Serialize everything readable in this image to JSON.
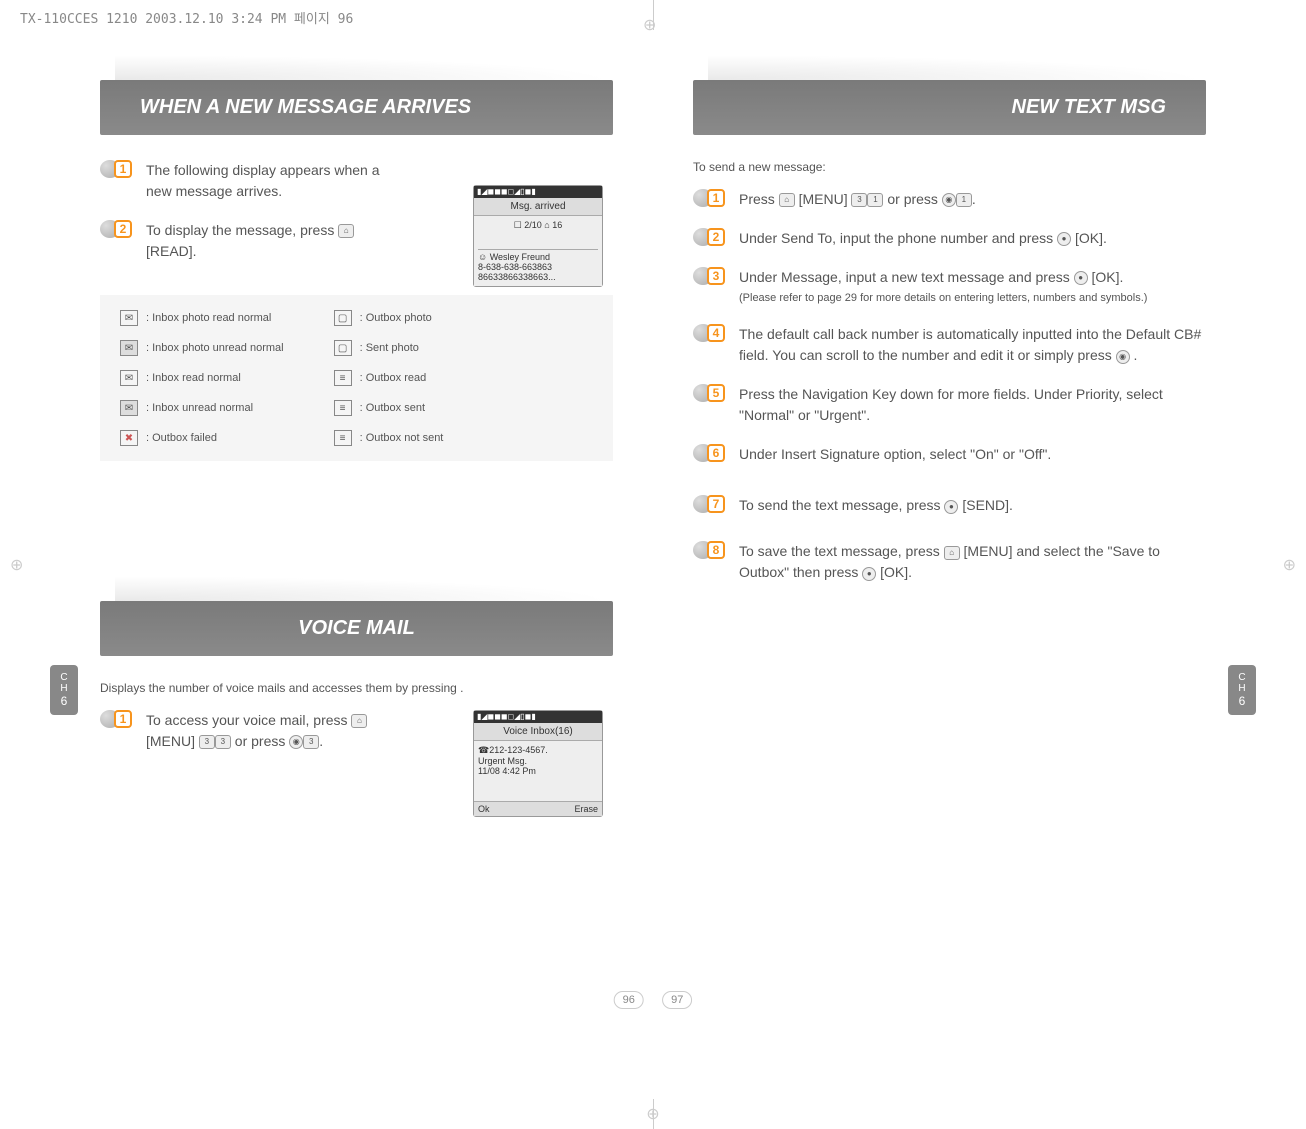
{
  "header_strip": "TX-110CCES 1210  2003.12.10 3:24 PM  페이지 96",
  "left": {
    "section1_title": "WHEN A NEW MESSAGE ARRIVES",
    "step1": "The following display appears when a new message arrives.",
    "step2_a": "To display the message, press ",
    "step2_b": " [READ].",
    "screen1": {
      "title": "Msg. arrived",
      "sub": "☐ 2/10      ⌂ 16",
      "body1": "☺ Wesley Freund",
      "body2": "8-638-638-663863",
      "body3": "86633866338663..."
    },
    "icons": {
      "c1": [
        ": Inbox photo read normal",
        ": Inbox photo unread normal",
        ": Inbox read normal",
        ": Inbox unread normal",
        ": Outbox failed"
      ],
      "c2": [
        ": Outbox photo",
        ": Sent photo",
        ": Outbox read",
        ": Outbox sent",
        ": Outbox not sent"
      ]
    },
    "section2_title": "VOICE MAIL",
    "voice_intro": "Displays the number of voice mails and accesses them by pressing      .",
    "voice_step1_a": "To access your voice mail, press ",
    "voice_step1_b": " [MENU] ",
    "voice_step1_c": " or press ",
    "voice_step1_d": ".",
    "screen2": {
      "title": "Voice Inbox(16)",
      "body1": "☎212-123-4567.",
      "body2": "Urgent Msg.",
      "body3": "11/08 4:42 Pm",
      "foot_l": "Ok",
      "foot_r": "Erase"
    }
  },
  "right": {
    "section_title": "NEW TEXT MSG",
    "intro": "To send a new message:",
    "step1_a": "Press ",
    "step1_b": " [MENU] ",
    "step1_c": " or press ",
    "step1_d": ".",
    "step2_a": "Under Send To, input the phone number and press ",
    "step2_b": " [OK].",
    "step3_a": "Under Message, input a new text message and press ",
    "step3_b": " [OK].",
    "step3_note": "(Please refer to page 29 for more details on entering letters, numbers and symbols.)",
    "step4_a": "The default call back number is automatically inputted into the Default CB# field.  You can scroll to the number and edit it or simply press ",
    "step4_b": " .",
    "step5": "Press the Navigation Key down for more fields. Under Priority, select \"Normal\" or \"Urgent\".",
    "step6": "Under Insert Signature option, select \"On\" or \"Off\".",
    "step7_a": "To send the text message, press ",
    "step7_b": " [SEND].",
    "step8_a": "To save the text message, press ",
    "step8_b": " [MENU] and select the \"Save to Outbox\" then press ",
    "step8_c": " [OK]."
  },
  "chapter": {
    "label_c": "C",
    "label_h": "H",
    "num": "6"
  },
  "page_left": "96",
  "page_right": "97"
}
